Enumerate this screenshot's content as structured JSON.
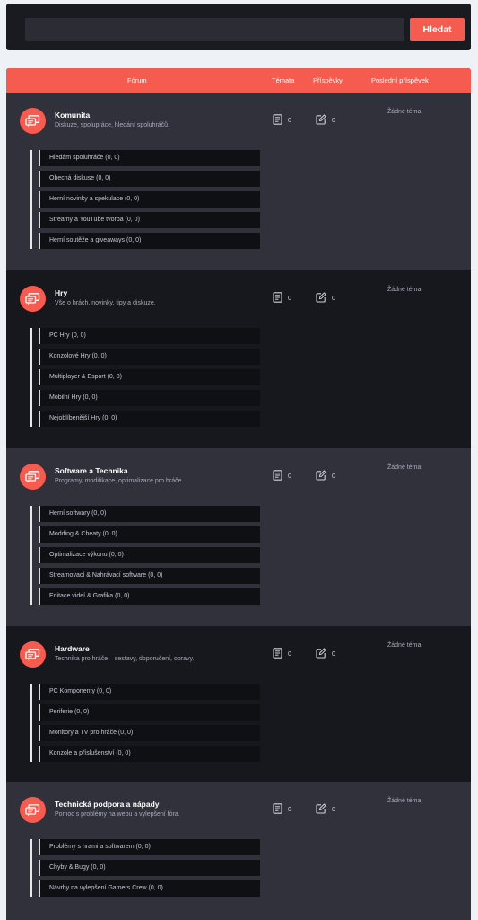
{
  "search": {
    "placeholder": "",
    "button_label": "Hledat"
  },
  "table_header": {
    "forum": "Fórum",
    "topics": "Témata",
    "posts": "Příspěvky",
    "last_post": "Poslední příspěvek"
  },
  "colors": {
    "accent": "#f65b50",
    "section_light": "#30313b",
    "section_dark": "#17181d"
  },
  "categories": [
    {
      "title": "Komunita",
      "description": "Diskuze, spolupráce, hledání spoluhráčů.",
      "topics": "0",
      "posts": "0",
      "last_post": "Žádné téma",
      "subforums": [
        "Hledám spoluhráče (0, 0)",
        "Obecná diskuse (0, 0)",
        "Herní novinky a spekulace (0, 0)",
        "Streamy a YouTube tvorba (0, 0)",
        "Herní soutěže a giveaways (0, 0)"
      ]
    },
    {
      "title": "Hry",
      "description": "Vše o hrách, novinky, tipy a diskuze.",
      "topics": "0",
      "posts": "0",
      "last_post": "Žádné téma",
      "subforums": [
        "PC Hry (0, 0)",
        "Konzolové Hry (0, 0)",
        "Multiplayer & Esport (0, 0)",
        "Mobilní Hry (0, 0)",
        "Nejoblíbenější Hry (0, 0)"
      ]
    },
    {
      "title": "Software a Technika",
      "description": "Programy, modifikace, optimalizace pro hráče.",
      "topics": "0",
      "posts": "0",
      "last_post": "Žádné téma",
      "subforums": [
        "Herní softwary (0, 0)",
        "Modding & Cheaty (0, 0)",
        "Optimalizace výkonu (0, 0)",
        "Streamovací & Nahrávací software (0, 0)",
        "Editace videí & Grafika (0, 0)"
      ]
    },
    {
      "title": "Hardware",
      "description": "Technika pro hráče – sestavy, doporučení, opravy.",
      "topics": "0",
      "posts": "0",
      "last_post": "Žádné téma",
      "subforums": [
        "PC Komponenty (0, 0)",
        "Periferie (0, 0)",
        "Monitory a TV pro hráče (0, 0)",
        "Konzole a příslušenství (0, 0)"
      ]
    },
    {
      "title": "Technická podpora a nápady",
      "description": "Pomoc s problémy na webu a vylepšení fóra.",
      "topics": "0",
      "posts": "0",
      "last_post": "Žádné téma",
      "subforums": [
        "Problémy s hrami a softwarem (0, 0)",
        "Chyby & Bugy (0, 0)",
        "Návrhy na vylepšení Gamers Crew (0, 0)"
      ]
    }
  ]
}
